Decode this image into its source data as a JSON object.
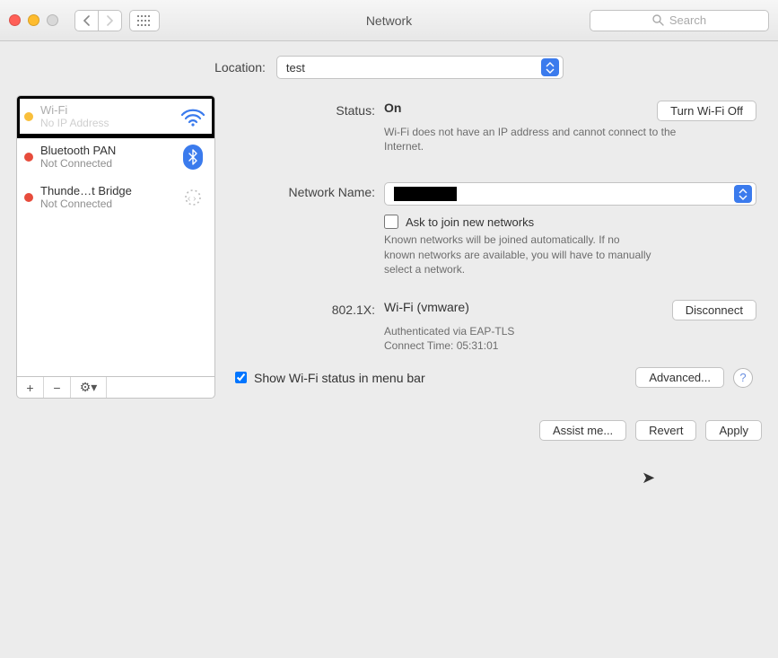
{
  "window": {
    "title": "Network",
    "searchPlaceholder": "Search"
  },
  "location": {
    "label": "Location:",
    "value": "test"
  },
  "sidebar": {
    "items": [
      {
        "name": "Wi-Fi",
        "sub": "No IP Address",
        "dot": "yellow",
        "icon": "wifi-icon",
        "highlighted": true
      },
      {
        "name": "Bluetooth PAN",
        "sub": "Not Connected",
        "dot": "red",
        "icon": "bluetooth-icon"
      },
      {
        "name": "Thunde…t Bridge",
        "sub": "Not Connected",
        "dot": "red",
        "icon": "thunderbolt-icon"
      }
    ],
    "addLabel": "+",
    "removeLabel": "−",
    "gearLabel": "⚙︎▾"
  },
  "detail": {
    "statusLabel": "Status:",
    "statusValue": "On",
    "toggleWifiLabel": "Turn Wi-Fi Off",
    "statusHelp": "Wi-Fi does not have an IP address and cannot connect to the Internet.",
    "networkNameLabel": "Network Name:",
    "networkNameValue": "",
    "askJoinLabel": "Ask to join new networks",
    "askJoinHelp": "Known networks will be joined automatically. If no known networks are available, you will have to manually select a network.",
    "dot1xLabel": "802.1X:",
    "dot1xValue": "Wi-Fi (vmware)",
    "dot1xButton": "Disconnect",
    "dot1xAuth": "Authenticated via EAP-TLS",
    "dot1xTime": "Connect Time: 05:31:01",
    "showStatusLabel": "Show Wi-Fi status in menu bar",
    "advancedLabel": "Advanced...",
    "helpLabel": "?"
  },
  "buttons": {
    "assist": "Assist me...",
    "revert": "Revert",
    "apply": "Apply"
  }
}
